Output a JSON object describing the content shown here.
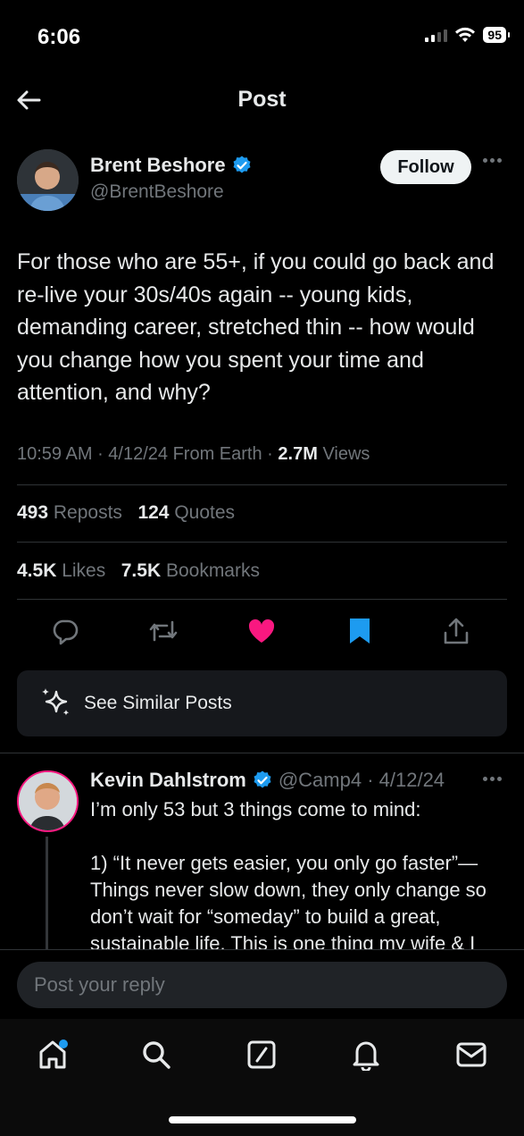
{
  "status_bar": {
    "time": "6:06",
    "battery": "95"
  },
  "header": {
    "title": "Post"
  },
  "post": {
    "author_name": "Brent Beshore",
    "handle": "@BrentBeshore",
    "follow_label": "Follow",
    "text": "For those who are 55+, if you could go back and re-live your 30s/40s again -- young kids, demanding career, stretched thin -- how would you change how you spent your time and attention, and why?",
    "time": "10:59 AM",
    "date": "4/12/24",
    "source": "From Earth",
    "views_count": "2.7M",
    "views_label": "Views",
    "reposts_count": "493",
    "reposts_label": "Reposts",
    "quotes_count": "124",
    "quotes_label": "Quotes",
    "likes_count": "4.5K",
    "likes_label": "Likes",
    "bookmarks_count": "7.5K",
    "bookmarks_label": "Bookmarks"
  },
  "similar": {
    "label": "See Similar Posts"
  },
  "reply": {
    "author_name": "Kevin Dahlstrom",
    "handle_date": "@Camp4 · 4/12/24",
    "text": "I’m only 53 but 3 things come to mind:\n\n1) “It never gets easier, you only go faster”— Things never slow down, they only change so don’t wait for “someday” to build a great, sustainable life. This is one thing my wife & I"
  },
  "composer": {
    "placeholder": "Post your reply"
  },
  "colors": {
    "like": "#f91880",
    "bookmark": "#1d9bf0",
    "verified": "#1d9bf0",
    "muted": "#71767b"
  },
  "nav": [
    "home-icon",
    "search-icon",
    "compose-icon",
    "notifications-icon",
    "messages-icon"
  ]
}
